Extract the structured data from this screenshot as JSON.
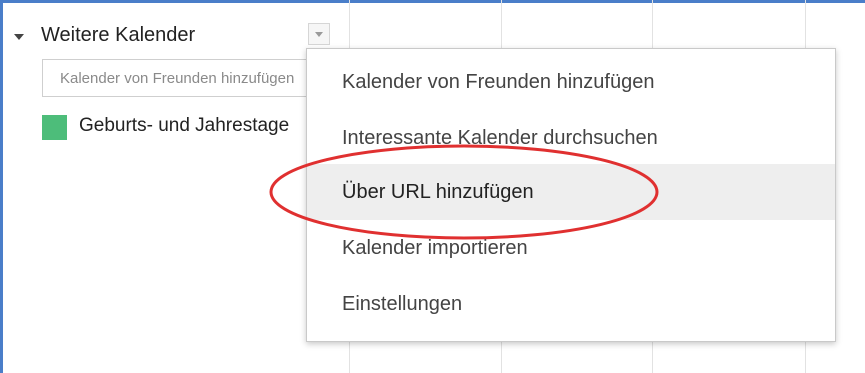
{
  "sidebar": {
    "section_title": "Weitere Kalender",
    "add_input": {
      "placeholder": "Kalender von Freunden hinzufügen",
      "value": ""
    },
    "calendars": [
      {
        "label": "Geburts- und Jahrestage",
        "color": "#4dbd7a"
      }
    ]
  },
  "grid": {
    "edge_char": "r"
  },
  "menu": {
    "items": [
      {
        "label": "Kalender von Freunden hinzufügen"
      },
      {
        "label": "Interessante Kalender durchsuchen"
      },
      {
        "label": "Über URL hinzufügen",
        "highlighted": true
      },
      {
        "label": "Kalender importieren"
      },
      {
        "label": "Einstellungen"
      }
    ]
  },
  "annotation": {
    "color": "#e03030",
    "target": "Über URL hinzufügen"
  },
  "colors": {
    "frame": "#4a7ec9",
    "menu_hover": "#eeeeee"
  }
}
